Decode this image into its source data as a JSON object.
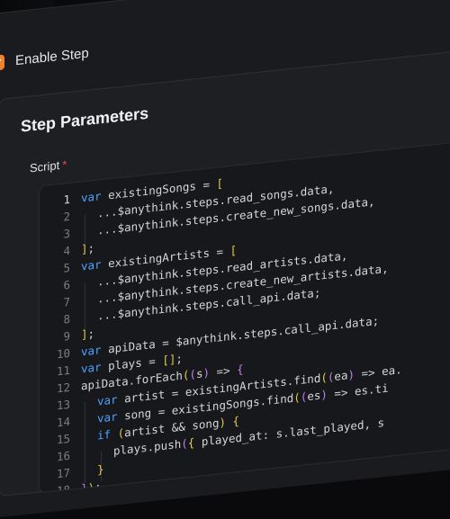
{
  "enable_step": {
    "label": "Enable Step",
    "checked": true,
    "accent": "#f0832a",
    "icon": "checkmark-icon"
  },
  "params": {
    "title": "Step Parameters",
    "script_label": "Script",
    "required_mark": "*"
  },
  "editor": {
    "active_line": 1,
    "colors": {
      "keyword": "#4ea3ff",
      "bracket": "#e6c84a",
      "paren": "#c17cf0",
      "text": "#d6d6d9"
    },
    "lines": [
      {
        "n": "1",
        "indent": 0,
        "tokens": [
          {
            "t": "var",
            "c": "kw"
          },
          {
            "t": " existingSongs = ",
            "c": "pl"
          },
          {
            "t": "[",
            "c": "br"
          }
        ]
      },
      {
        "n": "2",
        "indent": 1,
        "tokens": [
          {
            "t": "...$anythink.steps.read_songs.data,",
            "c": "pl"
          }
        ]
      },
      {
        "n": "3",
        "indent": 1,
        "tokens": [
          {
            "t": "...$anythink.steps.create_new_songs.data,",
            "c": "pl"
          }
        ]
      },
      {
        "n": "4",
        "indent": 0,
        "tokens": [
          {
            "t": "]",
            "c": "br"
          },
          {
            "t": ";",
            "c": "pl"
          }
        ]
      },
      {
        "n": "5",
        "indent": 0,
        "tokens": [
          {
            "t": "var",
            "c": "kw"
          },
          {
            "t": " existingArtists = ",
            "c": "pl"
          },
          {
            "t": "[",
            "c": "br"
          }
        ]
      },
      {
        "n": "6",
        "indent": 1,
        "tokens": [
          {
            "t": "...$anythink.steps.read_artists.data,",
            "c": "pl"
          }
        ]
      },
      {
        "n": "7",
        "indent": 1,
        "tokens": [
          {
            "t": "...$anythink.steps.create_new_artists.data,",
            "c": "pl"
          }
        ]
      },
      {
        "n": "8",
        "indent": 1,
        "tokens": [
          {
            "t": "...$anythink.steps.call_api.data;",
            "c": "pl"
          }
        ]
      },
      {
        "n": "9",
        "indent": 0,
        "tokens": [
          {
            "t": "]",
            "c": "br"
          },
          {
            "t": ";",
            "c": "pl"
          }
        ]
      },
      {
        "n": "10",
        "indent": 0,
        "tokens": [
          {
            "t": "var",
            "c": "kw"
          },
          {
            "t": " apiData = $anythink.steps.call_api.data;",
            "c": "pl"
          }
        ]
      },
      {
        "n": "11",
        "indent": 0,
        "tokens": [
          {
            "t": "var",
            "c": "kw"
          },
          {
            "t": " plays = ",
            "c": "pl"
          },
          {
            "t": "[]",
            "c": "br"
          },
          {
            "t": ";",
            "c": "pl"
          }
        ]
      },
      {
        "n": "12",
        "indent": 0,
        "tokens": [
          {
            "t": "apiData.forEach",
            "c": "pl"
          },
          {
            "t": "(",
            "c": "br"
          },
          {
            "t": "(",
            "c": "pu"
          },
          {
            "t": "s",
            "c": "pl"
          },
          {
            "t": ")",
            "c": "pu"
          },
          {
            "t": " => ",
            "c": "pl"
          },
          {
            "t": "{",
            "c": "pu"
          }
        ]
      },
      {
        "n": "13",
        "indent": 1,
        "tokens": [
          {
            "t": "var",
            "c": "kw"
          },
          {
            "t": " artist = existingArtists.find",
            "c": "pl"
          },
          {
            "t": "(",
            "c": "br"
          },
          {
            "t": "(",
            "c": "pu"
          },
          {
            "t": "ea",
            "c": "pl"
          },
          {
            "t": ")",
            "c": "pu"
          },
          {
            "t": " => ea.",
            "c": "pl"
          }
        ]
      },
      {
        "n": "14",
        "indent": 1,
        "tokens": [
          {
            "t": "var",
            "c": "kw"
          },
          {
            "t": " song = existingSongs.find",
            "c": "pl"
          },
          {
            "t": "(",
            "c": "br"
          },
          {
            "t": "(",
            "c": "pu"
          },
          {
            "t": "es",
            "c": "pl"
          },
          {
            "t": ")",
            "c": "pu"
          },
          {
            "t": " => es.ti",
            "c": "pl"
          }
        ]
      },
      {
        "n": "15",
        "indent": 1,
        "tokens": [
          {
            "t": "if",
            "c": "kw"
          },
          {
            "t": " ",
            "c": "pl"
          },
          {
            "t": "(",
            "c": "br"
          },
          {
            "t": "artist && song",
            "c": "pl"
          },
          {
            "t": ")",
            "c": "br"
          },
          {
            "t": " ",
            "c": "pl"
          },
          {
            "t": "{",
            "c": "br"
          }
        ]
      },
      {
        "n": "16",
        "indent": 2,
        "tokens": [
          {
            "t": "plays.push",
            "c": "pl"
          },
          {
            "t": "(",
            "c": "pu"
          },
          {
            "t": "{",
            "c": "br"
          },
          {
            "t": " played_at: s.last_played, s",
            "c": "pl"
          }
        ]
      },
      {
        "n": "17",
        "indent": 1,
        "tokens": [
          {
            "t": "}",
            "c": "br"
          }
        ]
      },
      {
        "n": "18",
        "indent": 0,
        "tokens": [
          {
            "t": "}",
            "c": "pu"
          },
          {
            "t": ")",
            "c": "br"
          },
          {
            "t": ";",
            "c": "pl"
          }
        ]
      }
    ]
  }
}
